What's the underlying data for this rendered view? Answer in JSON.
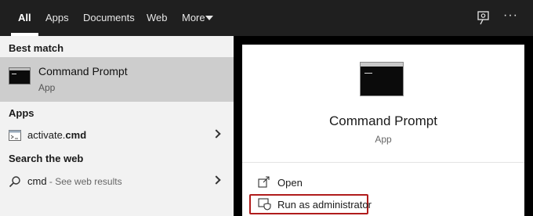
{
  "topbar": {
    "tabs": [
      {
        "label": "All",
        "active": true
      },
      {
        "label": "Apps"
      },
      {
        "label": "Documents"
      },
      {
        "label": "Web"
      },
      {
        "label": "More"
      }
    ],
    "feedback_icon": "feedback-icon",
    "more_options_icon": "ellipsis-icon",
    "ellipsis": "···"
  },
  "left": {
    "best_match_heading": "Best match",
    "best_match": {
      "title": "Command Prompt",
      "subtitle": "App",
      "icon": "command-prompt-icon"
    },
    "apps_heading": "Apps",
    "apps": [
      {
        "prefix": "activate.",
        "bold": "cmd",
        "icon": "script-file-icon"
      }
    ],
    "web_heading": "Search the web",
    "web": [
      {
        "query": "cmd",
        "suffix": " - See web results",
        "icon": "search-icon"
      }
    ]
  },
  "right": {
    "title": "Command Prompt",
    "subtitle": "App",
    "actions": [
      {
        "label": "Open",
        "icon": "open-icon"
      },
      {
        "label": "Run as administrator",
        "icon": "shield-icon"
      }
    ]
  },
  "colors": {
    "topbar_bg": "#1f1f1f",
    "left_bg": "#f2f2f2",
    "selected_row": "#cdcdcd",
    "highlight_border": "#b01c1c"
  }
}
